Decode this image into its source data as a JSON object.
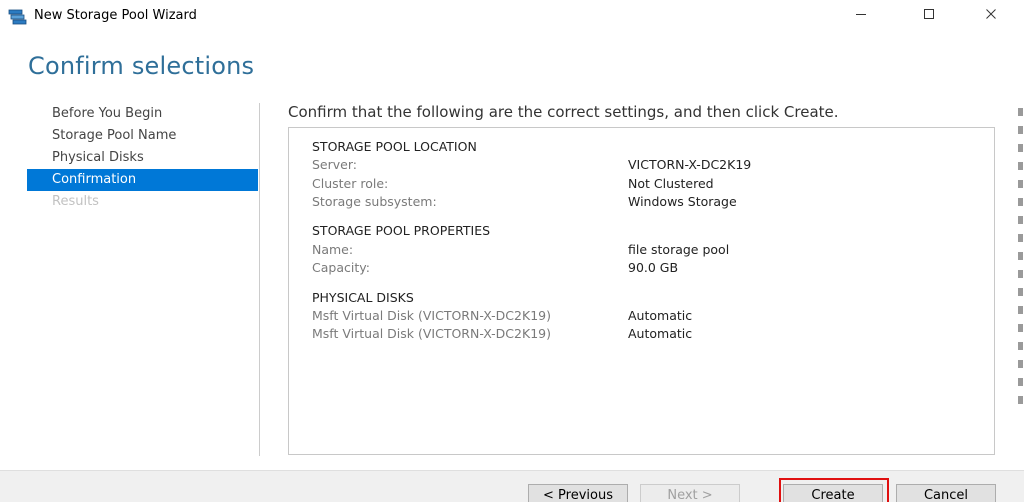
{
  "window": {
    "title": "New Storage Pool Wizard",
    "icons": {
      "app": "storage-pool-icon",
      "minimize": "minimize-icon",
      "maximize": "maximize-icon",
      "close": "close-icon"
    }
  },
  "header": {
    "title": "Confirm selections"
  },
  "nav": {
    "items": [
      {
        "label": "Before You Begin",
        "state": "normal"
      },
      {
        "label": "Storage Pool Name",
        "state": "normal"
      },
      {
        "label": "Physical Disks",
        "state": "normal"
      },
      {
        "label": "Confirmation",
        "state": "selected"
      },
      {
        "label": "Results",
        "state": "disabled"
      }
    ]
  },
  "main": {
    "instruction": "Confirm that the following are the correct settings, and then click Create.",
    "sections": [
      {
        "heading": "STORAGE POOL LOCATION",
        "rows": [
          {
            "label": "Server:",
            "value": "VICTORN-X-DC2K19"
          },
          {
            "label": "Cluster role:",
            "value": "Not Clustered"
          },
          {
            "label": "Storage subsystem:",
            "value": "Windows Storage"
          }
        ]
      },
      {
        "heading": "STORAGE POOL PROPERTIES",
        "rows": [
          {
            "label": "Name:",
            "value": "file storage pool"
          },
          {
            "label": "Capacity:",
            "value": "90.0 GB"
          }
        ]
      },
      {
        "heading": "PHYSICAL DISKS",
        "rows": [
          {
            "label": "Msft Virtual Disk (VICTORN-X-DC2K19)",
            "value": "Automatic"
          },
          {
            "label": "Msft Virtual Disk (VICTORN-X-DC2K19)",
            "value": "Automatic"
          }
        ]
      }
    ]
  },
  "footer": {
    "previous_label": "< Previous",
    "next_label": "Next >",
    "create_label": "Create",
    "cancel_label": "Cancel"
  },
  "colors": {
    "accent": "#0078d7",
    "title": "#2f6f99",
    "highlight": "#e01010"
  }
}
